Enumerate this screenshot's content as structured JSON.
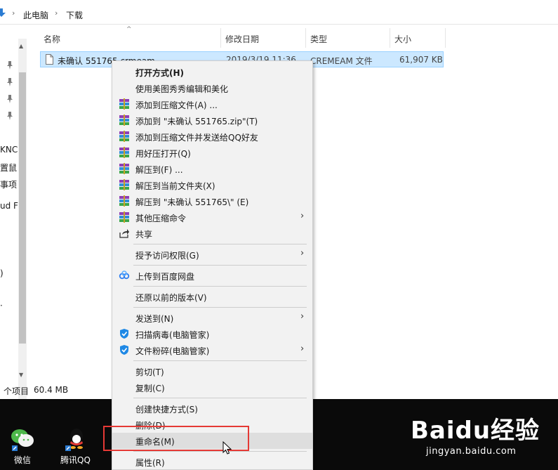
{
  "address": {
    "crumbs": [
      "此电脑",
      "下载"
    ],
    "separator": "›"
  },
  "nav": {
    "items": [
      "KNC",
      "置鼠",
      "事项",
      "ud F",
      ")",
      "·"
    ],
    "scroll_up": "▲",
    "scroll_down": "▼"
  },
  "columns": {
    "name": "名称",
    "date": "修改日期",
    "type": "类型",
    "size": "大小",
    "sort_indicator": "^"
  },
  "file": {
    "name": "未确认 551765.crmeam",
    "date": "2019/3/19 11:36",
    "type": "CREMEAM 文件",
    "size": "61,907 KB"
  },
  "status": {
    "count": "个项目",
    "size": "60.4 MB"
  },
  "taskbar": {
    "items": [
      {
        "label": "微信",
        "icon": "wechat-icon"
      },
      {
        "label": "腾讯QQ",
        "icon": "qq-icon"
      }
    ]
  },
  "watermark": {
    "logo": "Baidu经验",
    "url": "jingyan.baidu.com"
  },
  "menu": {
    "items": [
      {
        "label": "打开方式(H)",
        "bold": true,
        "icon": ""
      },
      {
        "label": "使用美图秀秀编辑和美化",
        "icon": ""
      },
      {
        "label": "添加到压缩文件(A) ...",
        "icon": "winrar-icon"
      },
      {
        "label": "添加到 \"未确认 551765.zip\"(T)",
        "icon": "winrar-icon"
      },
      {
        "label": "添加到压缩文件并发送给QQ好友",
        "icon": "winrar-icon"
      },
      {
        "label": "用好压打开(Q)",
        "icon": "winrar-icon"
      },
      {
        "label": "解压到(F) ...",
        "icon": "winrar-icon"
      },
      {
        "label": "解压到当前文件夹(X)",
        "icon": "winrar-icon"
      },
      {
        "label": "解压到 \"未确认 551765\\\" (E)",
        "icon": "winrar-icon"
      },
      {
        "label": "其他压缩命令",
        "icon": "winrar-icon",
        "submenu": true
      },
      {
        "label": "共享",
        "icon": "share-icon"
      },
      {
        "label": "授予访问权限(G)",
        "icon": "",
        "submenu": true
      },
      {
        "label": "上传到百度网盘",
        "icon": "baidu-netdisk-icon"
      },
      {
        "label": "还原以前的版本(V)",
        "icon": ""
      },
      {
        "label": "发送到(N)",
        "icon": "",
        "submenu": true
      },
      {
        "label": "扫描病毒(电脑管家)",
        "icon": "tencent-pc-manager-icon"
      },
      {
        "label": "文件粉碎(电脑管家)",
        "icon": "tencent-pc-manager-icon",
        "submenu": true
      },
      {
        "label": "剪切(T)",
        "icon": ""
      },
      {
        "label": "复制(C)",
        "icon": ""
      },
      {
        "label": "创建快捷方式(S)",
        "icon": ""
      },
      {
        "label": "删除(D)",
        "icon": ""
      },
      {
        "label": "重命名(M)",
        "icon": "",
        "highlighted": true
      },
      {
        "label": "属性(R)",
        "icon": ""
      }
    ],
    "submenu_glyph": "›"
  },
  "colors": {
    "selection_bg": "#cce8ff",
    "selection_border": "#99d1ff",
    "annotation_red": "#e53935",
    "taskbar": "#0a0a0a"
  }
}
